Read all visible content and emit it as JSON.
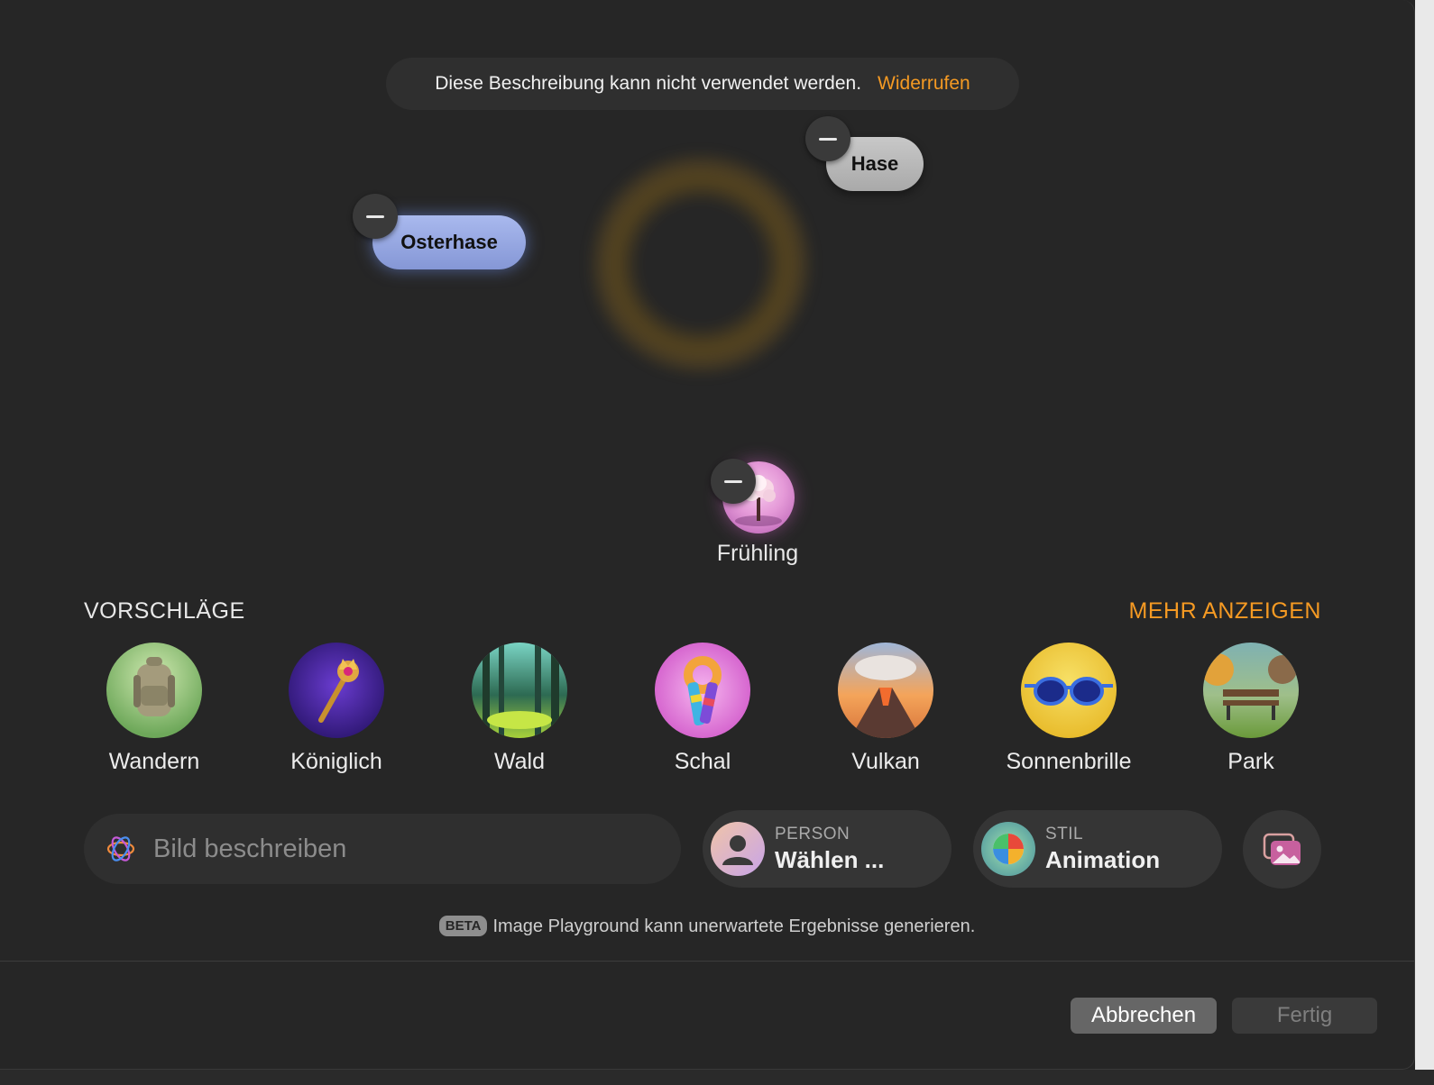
{
  "toast": {
    "message": "Diese Beschreibung kann nicht verwendet werden.",
    "action": "Widerrufen"
  },
  "concepts": {
    "osterhase": "Osterhase",
    "hase": "Hase",
    "fruehling": "Frühling"
  },
  "suggestions": {
    "title": "VORSCHLÄGE",
    "more": "MEHR ANZEIGEN",
    "items": [
      {
        "label": "Wandern",
        "icon": "backpack"
      },
      {
        "label": "Königlich",
        "icon": "scepter"
      },
      {
        "label": "Wald",
        "icon": "forest"
      },
      {
        "label": "Schal",
        "icon": "scarf"
      },
      {
        "label": "Vulkan",
        "icon": "volcano"
      },
      {
        "label": "Sonnenbrille",
        "icon": "sunglasses"
      },
      {
        "label": "Park",
        "icon": "park-bench"
      }
    ]
  },
  "input": {
    "placeholder": "Bild beschreiben"
  },
  "person": {
    "label": "PERSON",
    "value": "Wählen ..."
  },
  "style": {
    "label": "STIL",
    "value": "Animation"
  },
  "footer": {
    "badge": "BETA",
    "notice": "Image Playground kann unerwartete Ergebnisse generieren."
  },
  "buttons": {
    "cancel": "Abbrechen",
    "done": "Fertig"
  },
  "colors": {
    "accent": "#f59a23",
    "background": "#262626"
  }
}
